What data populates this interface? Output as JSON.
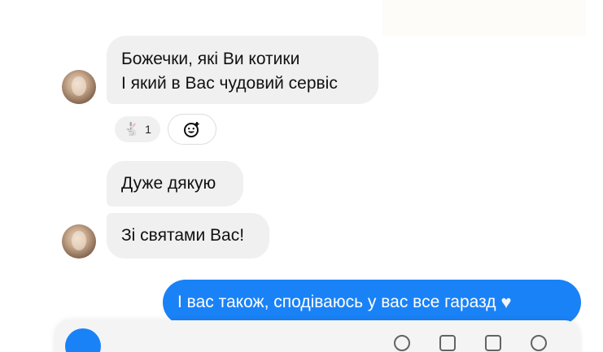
{
  "messages": {
    "incoming_1_line1": "Божечки, які Ви котики",
    "incoming_1_line2": "І який в Вас чудовий сервіс",
    "incoming_2": "Дуже дякую",
    "incoming_3": "Зі святами Вас!",
    "outgoing_1": "І вас також, сподіваюсь у вас все гаразд"
  },
  "reaction": {
    "emoji": "rabbit",
    "count": "1"
  },
  "icons": {
    "add_reaction": "add-reaction-icon",
    "outgoing_emoji": "white-heart"
  },
  "colors": {
    "incoming_bubble": "#f0f0f0",
    "outgoing_bubble": "#1a82f7",
    "outgoing_text": "#ffffff"
  }
}
